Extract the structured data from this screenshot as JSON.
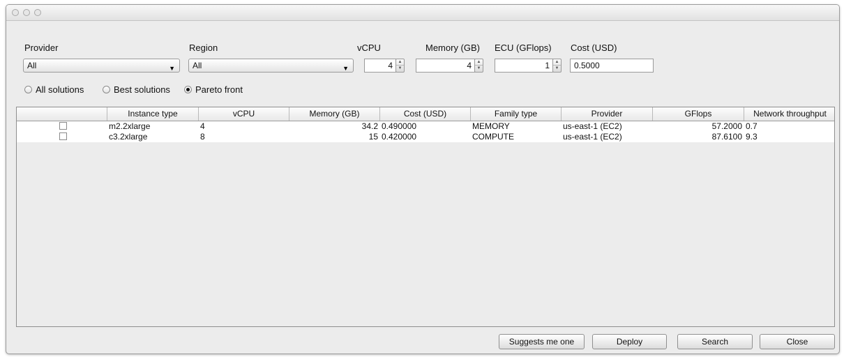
{
  "filters": {
    "provider": {
      "label": "Provider",
      "value": "All"
    },
    "region": {
      "label": "Region",
      "value": "All"
    },
    "vcpu": {
      "label": "vCPU",
      "value": "4"
    },
    "memory": {
      "label": "Memory (GB)",
      "value": "4"
    },
    "ecu": {
      "label": "ECU (GFlops)",
      "value": "1"
    },
    "cost": {
      "label": "Cost (USD)",
      "value": "0.5000"
    }
  },
  "modes": {
    "options": [
      "All solutions",
      "Best solutions",
      "Pareto front"
    ],
    "selected": "Pareto front"
  },
  "table": {
    "columns": [
      "",
      "Instance type",
      "vCPU",
      "Memory (GB)",
      "Cost (USD)",
      "Family type",
      "Provider",
      "GFlops",
      "Network throughput"
    ],
    "rows": [
      {
        "checked": false,
        "instance_type": "m2.2xlarge",
        "vcpu": "4",
        "memory": "34.2",
        "cost": "0.490000",
        "family": "MEMORY",
        "provider": "us-east-1 (EC2)",
        "gflops": "57.2000",
        "network": "0.7"
      },
      {
        "checked": false,
        "instance_type": "c3.2xlarge",
        "vcpu": "8",
        "memory": "15",
        "cost": "0.420000",
        "family": "COMPUTE",
        "provider": "us-east-1 (EC2)",
        "gflops": "87.6100",
        "network": "9.3"
      }
    ]
  },
  "buttons": {
    "suggest": "Suggests me one",
    "deploy": "Deploy",
    "search": "Search",
    "close": "Close"
  }
}
